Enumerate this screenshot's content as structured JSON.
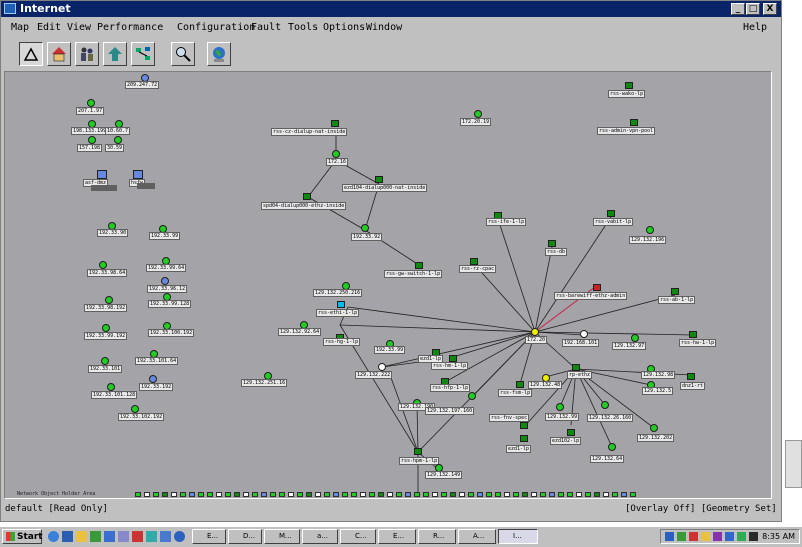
{
  "window": {
    "title": "Internet",
    "minimize": "_",
    "maximize": "□",
    "close": "X"
  },
  "menu": {
    "map": "Map",
    "edit": "Edit",
    "view": "View",
    "performance": "Performance",
    "configuration": "Configuration",
    "fault": "Fault",
    "tools": "Tools",
    "options": "Options",
    "window": "Window",
    "help": "Help"
  },
  "toolbar": {
    "icons": [
      "pointer-icon",
      "house-icon",
      "people-icon",
      "up-arrow-icon",
      "network-icon",
      "magnifier-icon",
      "globe-icon"
    ]
  },
  "nodes": {
    "n209": "209.247.72",
    "n207": "207.1.97",
    "n198a": "198.133.199",
    "n198b": "10.60.7",
    "n157": "157.198",
    "n30": "30.59",
    "asfdmz": "asf-dmz",
    "hsfw": "hsfw",
    "rss_cz": "rss-cz-dialup-nat-inside",
    "n172_16": "172.16",
    "ezd": "ezd104-dialup000-nat-inside",
    "spdsl": "spd04-dialup000-ethz-inside",
    "n192_33_92": "192.33.92",
    "swe": "rss-gw-switch-1-lp",
    "n172_20_19": "172.20.19",
    "rss_wako": "rss-wako-lp",
    "rss_admin": "rss-admin-vpn-pool",
    "rss_ife": "rss-ife-1-lp",
    "rss_vabit": "rss-vabit-lp",
    "n129_132_196": "129.132.196",
    "rss_rzcpac": "rss-rz-cpac",
    "rss_db": "rss-db",
    "rss_barewiff": "rss-barewiff-ethz-admin",
    "rss_ab": "rss-ab-1-lp",
    "n129_132_250": "129.132.250.216",
    "rss_ethi": "rss-ethi-1-lp",
    "n129_132_92": "129.132.92.64",
    "rss_hg": "rss-hg-1-lp",
    "n192_33_99": "192.33.99",
    "ezd1lp": "ezd1-lp",
    "n172_20": "172.20",
    "n192_168_101": "192.168.101",
    "n129_132_97": "129.132.97",
    "rss_hw": "rss-hw-1-lp",
    "rss_hm": "rss-hm-1-lp",
    "n129_132_222": "129.132.222",
    "rss_hfp": "rss-hfp-1-lp",
    "rss_fsm": "rss-fsm-lp",
    "rp_ethz": "rp-ethz",
    "n129_132_98": "129.132.98",
    "n129_132_48": "129.132.48",
    "n129_132_5": "129.132.5",
    "dnzt": "dnz1-rt",
    "n129_132_251": "129.132.251.16",
    "n129_132_190": "129.132.190",
    "n129_132_197": "129.132.197.160",
    "rss_fnvspec": "rss-fnv-spec",
    "n129_132_99": "129.132.99",
    "n129_132_26": "129.132.26.160",
    "ezd102": "ezd102-lp",
    "n129_132_202": "129.132.202",
    "ezd1": "ezd1-lp",
    "n129_132_64": "129.132.64",
    "rss_hpm": "rss-hpm-1-lp",
    "n129_132_149": "129.132.149",
    "l192_33_90": "192.33.90",
    "l192_33_99": "192.33.99",
    "l192_33_98": "192.33.98.64",
    "l192_33_99b": "192.33.99.64",
    "l192_33_96": "192.33.96.12",
    "l192_33_98b": "192.33.98.192",
    "l192_33_99c": "192.33.99.128",
    "l192_33_99d": "192.33.99.192",
    "l192_33_100": "192.33.100.192",
    "l192_33_101": "192.33.101.64",
    "l192_33_101b": "192.33.101",
    "l192_33_192": "192.33.192",
    "l192_33_101c": "192.33.101.128",
    "l192_33_102": "192.33.102.192"
  },
  "bottom_strip_label": "Network Object Holder Area",
  "status": {
    "left": "default [Read Only]",
    "right": "[Overlay Off] [Geometry Set]"
  },
  "taskbar": {
    "start": "Start",
    "time": "8:35 AM",
    "items": [
      "E...",
      "D...",
      "M...",
      "a...",
      "C...",
      "E...",
      "R...",
      "A...",
      "I..."
    ]
  },
  "colors": {
    "canvas": "#a3a3a8",
    "node_green": "#22cc22",
    "node_blue": "#6688dd",
    "node_yellow": "#eeee00",
    "node_red": "#cc2222"
  }
}
